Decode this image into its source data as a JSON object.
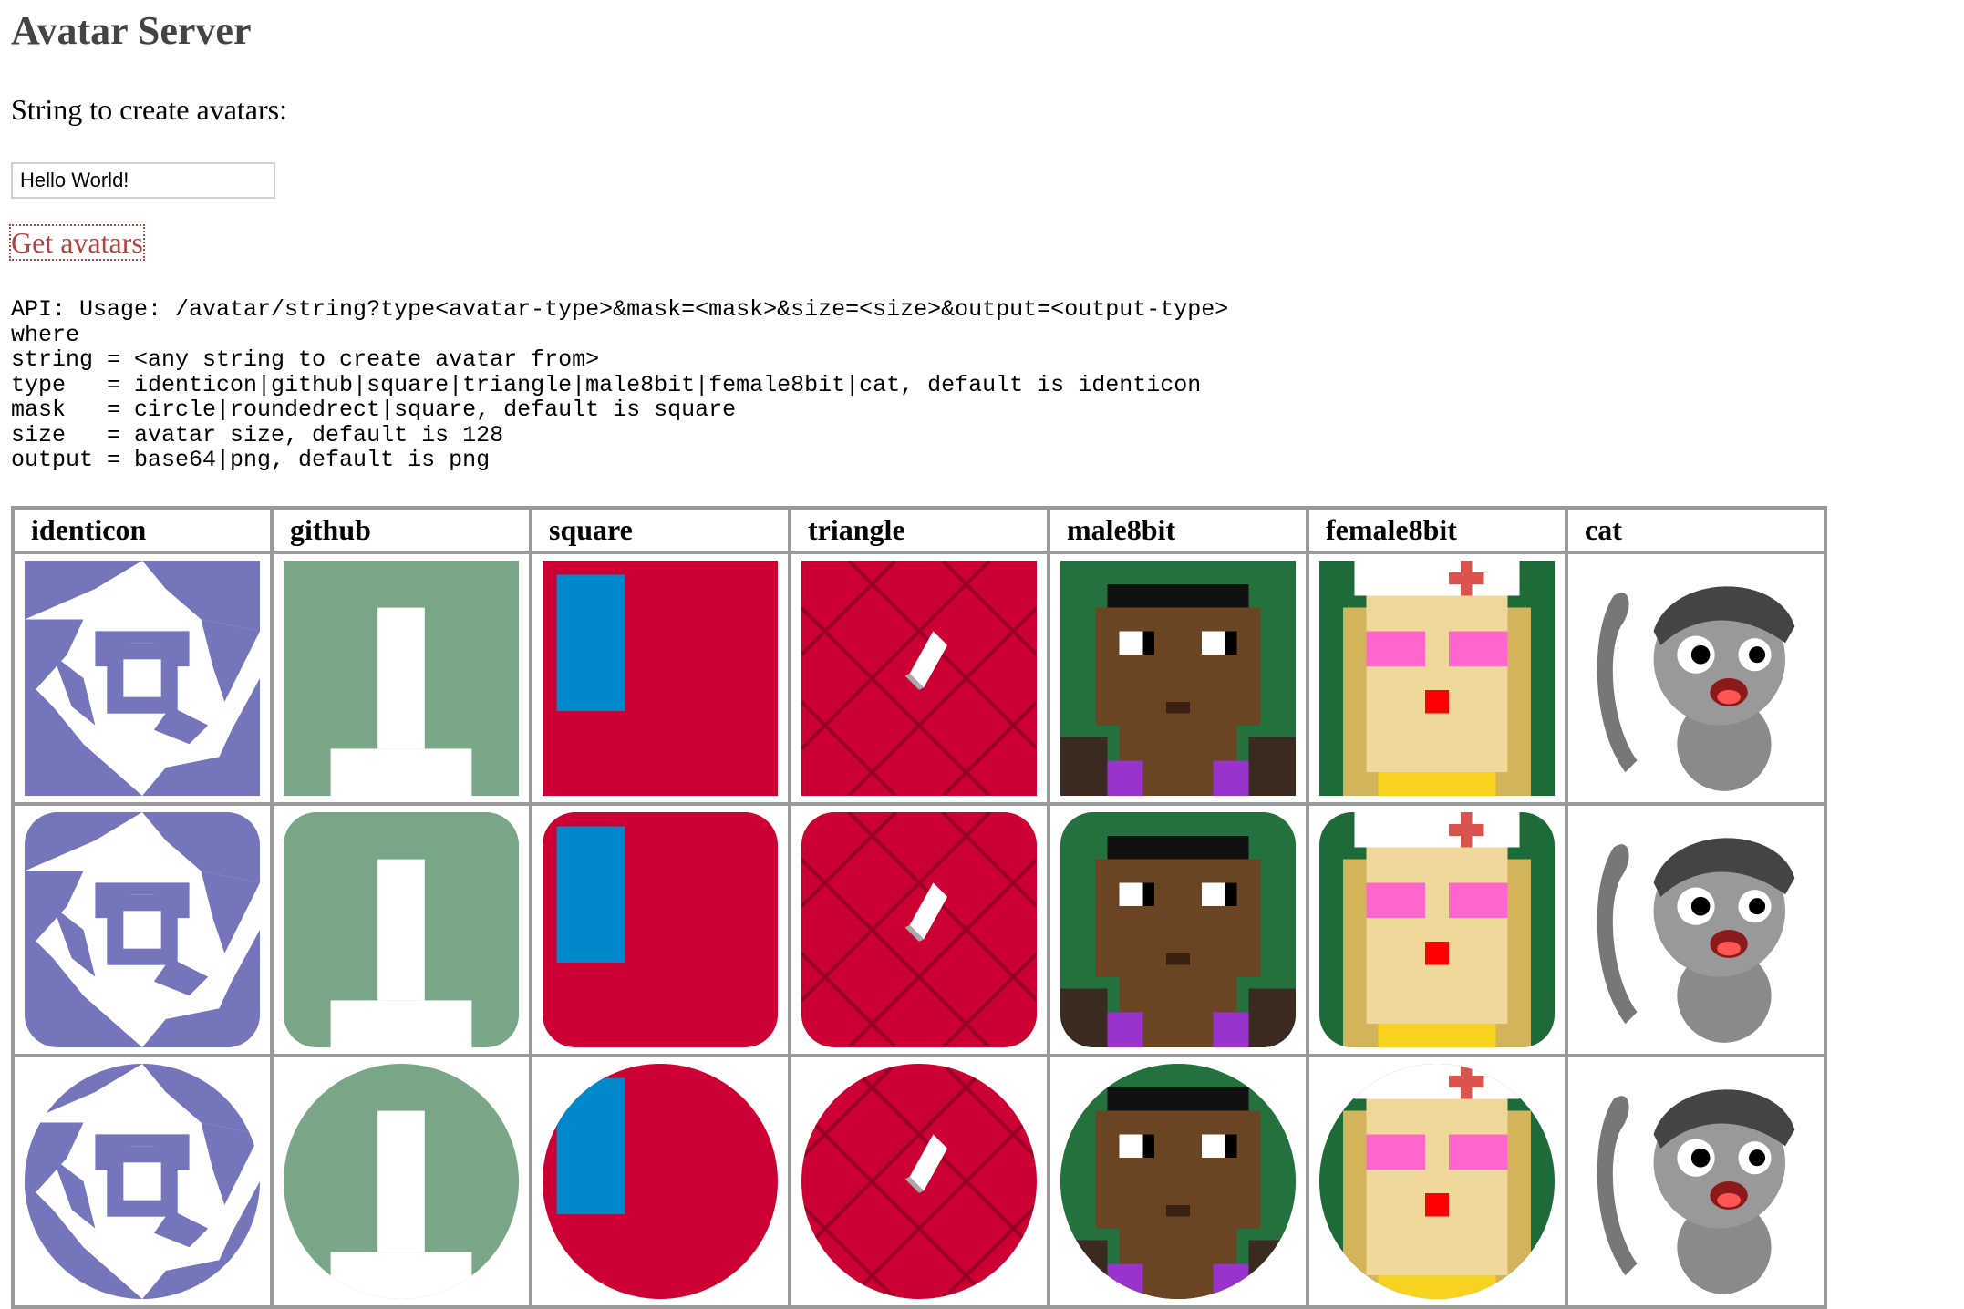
{
  "page": {
    "title": "Avatar Server",
    "prompt": "String to create avatars:",
    "input_value": "Hello World!",
    "submit_link": "Get avatars"
  },
  "api_usage": "API: Usage: /avatar/string?type<avatar-type>&mask=<mask>&size=<size>&output=<output-type>\nwhere\nstring = <any string to create avatar from>\ntype   = identicon|github|square|triangle|male8bit|female8bit|cat, default is identicon\nmask   = circle|roundedrect|square, default is square\nsize   = avatar size, default is 128\noutput = base64|png, default is png",
  "table": {
    "headers": [
      "identicon",
      "github",
      "square",
      "triangle",
      "male8bit",
      "female8bit",
      "cat"
    ],
    "masks": [
      "square",
      "roundedrect",
      "circle"
    ]
  },
  "colors": {
    "title": "#444444",
    "link": "#b5403f",
    "identicon": "#7575bb",
    "github": "#78a687",
    "square_bg": "#cc0033",
    "square_rect": "#0088cc",
    "triangle_bg": "#cc0033",
    "male8bit_bg": "#1e6b3a",
    "female8bit_bg": "#1e6b3a",
    "cat_gray": "#808080"
  },
  "icons": [
    "identicon-pinwheel-icon",
    "github-blocks-icon",
    "square-pattern-icon",
    "triangle-pattern-icon",
    "male8bit-face-icon",
    "female8bit-face-icon",
    "cat-bandana-icon"
  ]
}
